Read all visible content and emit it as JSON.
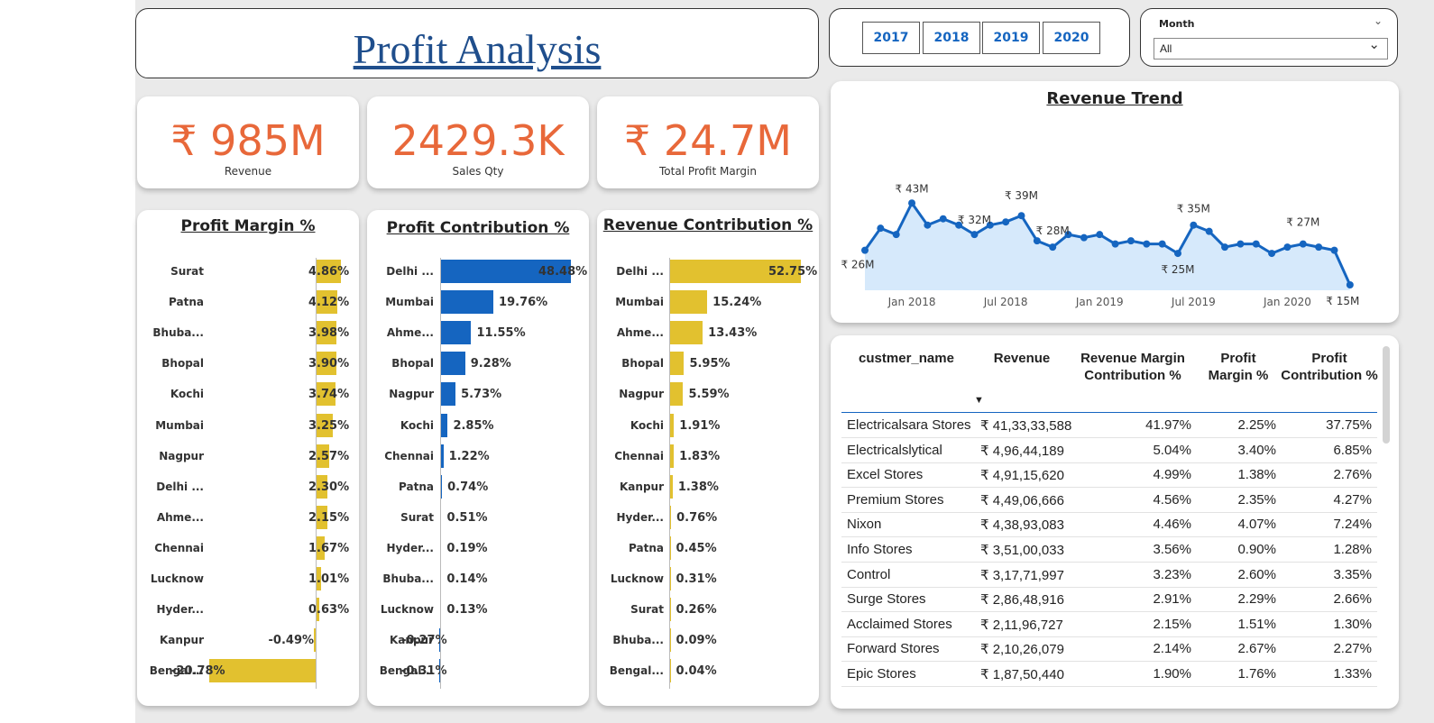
{
  "title": "Profit Analysis",
  "years": [
    "2017",
    "2018",
    "2019",
    "2020"
  ],
  "month_filter": {
    "label": "Month",
    "value": "All"
  },
  "kpis": [
    {
      "value": "₹ 985M",
      "label": "Revenue"
    },
    {
      "value": "2429.3K",
      "label": "Sales Qty"
    },
    {
      "value": "₹ 24.7M",
      "label": "Total Profit Margin"
    }
  ],
  "colors": {
    "accent": "#e8683a",
    "yellow": "#e2c12f",
    "blue": "#1565c0",
    "area": "#d6e9fb"
  },
  "bar_charts": [
    {
      "id": "pm",
      "title": "Profit Margin %",
      "color": "#e2c12f",
      "axis_min": -20.78,
      "axis_max": 4.86,
      "categories": [
        "Surat",
        "Patna",
        "Bhuba...",
        "Bhopal",
        "Kochi",
        "Mumbai",
        "Nagpur",
        "Delhi ...",
        "Ahme...",
        "Chennai",
        "Lucknow",
        "Hyder...",
        "Kanpur",
        "Bengal..."
      ],
      "values": [
        4.86,
        4.12,
        3.98,
        3.9,
        3.74,
        3.25,
        2.57,
        2.3,
        2.15,
        1.67,
        1.01,
        0.63,
        -0.49,
        -20.78
      ],
      "labels": [
        "4.86%",
        "4.12%",
        "3.98%",
        "3.90%",
        "3.74%",
        "3.25%",
        "2.57%",
        "2.30%",
        "2.15%",
        "1.67%",
        "1.01%",
        "0.63%",
        "-0.49%",
        "-20.78%"
      ]
    },
    {
      "id": "pc",
      "title": "Profit Contribution %",
      "color": "#1565c0",
      "axis_min": -0.31,
      "axis_max": 48.48,
      "categories": [
        "Delhi ...",
        "Mumbai",
        "Ahme...",
        "Bhopal",
        "Nagpur",
        "Kochi",
        "Chennai",
        "Patna",
        "Surat",
        "Hyder...",
        "Bhuba...",
        "Lucknow",
        "Kanpur",
        "Bengal..."
      ],
      "values": [
        48.48,
        19.76,
        11.55,
        9.28,
        5.73,
        2.85,
        1.22,
        0.74,
        0.51,
        0.19,
        0.14,
        0.13,
        -0.27,
        -0.31
      ],
      "labels": [
        "48.48%",
        "19.76%",
        "11.55%",
        "9.28%",
        "5.73%",
        "2.85%",
        "1.22%",
        "0.74%",
        "0.51%",
        "0.19%",
        "0.14%",
        "0.13%",
        "-0.27%",
        "-0.31%"
      ]
    },
    {
      "id": "rc",
      "title": "Revenue Contribution %",
      "color": "#e2c12f",
      "axis_min": 0,
      "axis_max": 52.75,
      "categories": [
        "Delhi ...",
        "Mumbai",
        "Ahme...",
        "Bhopal",
        "Nagpur",
        "Kochi",
        "Chennai",
        "Kanpur",
        "Hyder...",
        "Patna",
        "Lucknow",
        "Surat",
        "Bhuba...",
        "Bengal..."
      ],
      "values": [
        52.75,
        15.24,
        13.43,
        5.95,
        5.59,
        1.91,
        1.83,
        1.38,
        0.76,
        0.45,
        0.31,
        0.26,
        0.09,
        0.04
      ],
      "labels": [
        "52.75%",
        "15.24%",
        "13.43%",
        "5.95%",
        "5.59%",
        "1.91%",
        "1.83%",
        "1.38%",
        "0.76%",
        "0.45%",
        "0.31%",
        "0.26%",
        "0.09%",
        "0.04%"
      ]
    }
  ],
  "chart_data": {
    "type": "area",
    "title": "Revenue Trend",
    "x_ticks": [
      "Jan 2018",
      "Jul 2018",
      "Jan 2019",
      "Jul 2019",
      "Jan 2020"
    ],
    "x_start": "2017-10",
    "values_m": [
      26,
      33,
      31,
      41,
      34,
      36,
      34,
      31,
      34,
      35,
      37,
      29,
      27,
      31,
      30,
      31,
      28,
      29,
      28,
      28,
      25,
      34,
      32,
      27,
      28,
      28,
      25,
      27,
      28,
      27,
      26,
      15
    ],
    "point_labels": [
      {
        "i": 0,
        "text": "₹ 26M"
      },
      {
        "i": 3,
        "text": "₹ 43M"
      },
      {
        "i": 7,
        "text": "₹ 32M"
      },
      {
        "i": 10,
        "text": "₹ 39M"
      },
      {
        "i": 12,
        "text": "₹ 28M"
      },
      {
        "i": 20,
        "text": "₹ 25M"
      },
      {
        "i": 21,
        "text": "₹ 35M"
      },
      {
        "i": 28,
        "text": "₹ 27M"
      },
      {
        "i": 31,
        "text": "₹ 15M"
      }
    ]
  },
  "table": {
    "headers": [
      "custmer_name",
      "Revenue",
      "Revenue Margin Contribution %",
      "Profit Margin %",
      "Profit Contribution %"
    ],
    "rows": [
      [
        "Electricalsara Stores",
        "₹ 41,33,33,588",
        "41.97%",
        "2.25%",
        "37.75%"
      ],
      [
        "Electricalslytical",
        "₹ 4,96,44,189",
        "5.04%",
        "3.40%",
        "6.85%"
      ],
      [
        "Excel Stores",
        "₹ 4,91,15,620",
        "4.99%",
        "1.38%",
        "2.76%"
      ],
      [
        "Premium Stores",
        "₹ 4,49,06,666",
        "4.56%",
        "2.35%",
        "4.27%"
      ],
      [
        "Nixon",
        "₹ 4,38,93,083",
        "4.46%",
        "4.07%",
        "7.24%"
      ],
      [
        "Info Stores",
        "₹ 3,51,00,033",
        "3.56%",
        "0.90%",
        "1.28%"
      ],
      [
        "Control",
        "₹ 3,17,71,997",
        "3.23%",
        "2.60%",
        "3.35%"
      ],
      [
        "Surge Stores",
        "₹ 2,86,48,916",
        "2.91%",
        "2.29%",
        "2.66%"
      ],
      [
        "Acclaimed Stores",
        "₹ 2,11,96,727",
        "2.15%",
        "1.51%",
        "1.30%"
      ],
      [
        "Forward Stores",
        "₹ 2,10,26,079",
        "2.14%",
        "2.67%",
        "2.27%"
      ],
      [
        "Epic Stores",
        "₹ 1,87,50,440",
        "1.90%",
        "1.76%",
        "1.33%"
      ]
    ]
  }
}
